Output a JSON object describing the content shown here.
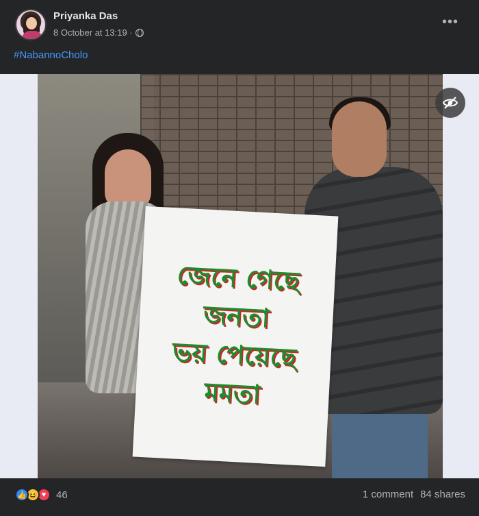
{
  "post": {
    "author": "Priyanka Das",
    "timestamp": "8 October at 13:19 ·",
    "privacy_icon": "globe-icon",
    "more_label": "•••",
    "hashtag": "#NabannoCholo"
  },
  "image": {
    "placard_lines": [
      "জেনে গেছে",
      "জনতা",
      "ভয় পেয়েছে",
      "মমতা"
    ],
    "hide_icon": "eye-slash-icon"
  },
  "footer": {
    "reactions": [
      "like-icon",
      "haha-icon",
      "love-icon"
    ],
    "reaction_count": "46",
    "comments": "1 comment",
    "shares": "84 shares"
  },
  "colors": {
    "background": "#242526",
    "link": "#4599ff",
    "text_secondary": "#b0b3b8",
    "placard_text": "#1f8a2e",
    "placard_outline": "#c62828"
  }
}
